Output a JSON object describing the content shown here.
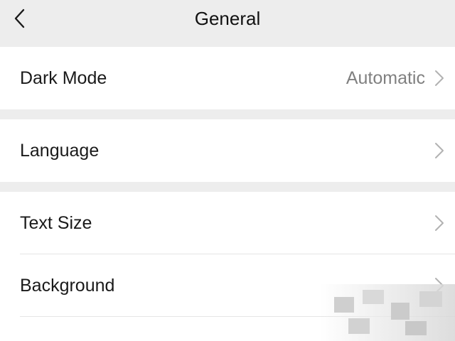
{
  "header": {
    "title": "General",
    "back_icon": "chevron-left-icon"
  },
  "groups": [
    {
      "rows": [
        {
          "label": "Dark Mode",
          "value": "Automatic",
          "icon": "chevron-right-icon"
        }
      ]
    },
    {
      "rows": [
        {
          "label": "Language",
          "value": "",
          "icon": "chevron-right-icon"
        }
      ]
    },
    {
      "rows": [
        {
          "label": "Text Size",
          "value": "",
          "icon": "chevron-right-icon"
        },
        {
          "label": "Background",
          "value": "",
          "icon": "chevron-right-icon"
        }
      ]
    }
  ],
  "colors": {
    "background": "#ededed",
    "cell": "#ffffff",
    "text": "#1a1a1a",
    "secondary_text": "#808080",
    "chevron": "#b2b2b2"
  }
}
